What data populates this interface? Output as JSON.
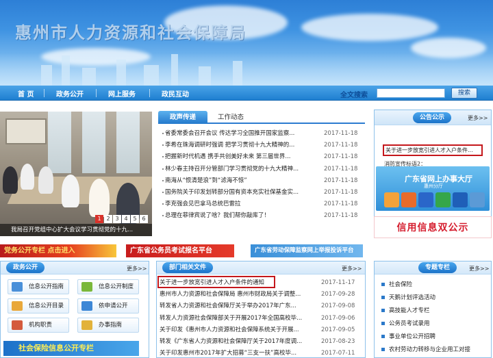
{
  "header": {
    "title": "惠州市人力资源和社会保障局"
  },
  "nav": {
    "items": [
      "首 页",
      "政务公开",
      "网上服务",
      "政民互动"
    ],
    "search_label": "全文搜索",
    "search_button": "搜索"
  },
  "slider": {
    "caption": "我局召开党组中心扩大会议学习贯彻党的十九...",
    "pages": [
      "1",
      "2",
      "3",
      "4",
      "5",
      "6"
    ]
  },
  "news_tabs": {
    "tabs": [
      "政声传递",
      "工作动态"
    ],
    "items": [
      {
        "title": "省委常委会召开会议 传达学习全国推开国家监察...",
        "date": "2017-11-18"
      },
      {
        "title": "李希在珠海调研时强调 把学习贯彻十九大精神的...",
        "date": "2017-11-18"
      },
      {
        "title": "把握新时代机遇 携手共创美好未来 第三届世界...",
        "date": "2017-11-18"
      },
      {
        "title": "林少春主持召开分管部门学习贯彻党的十九大精神...",
        "date": "2017-11-18"
      },
      {
        "title": "南海从“恨清楚浪”到“滤海不惊”",
        "date": "2017-11-18"
      },
      {
        "title": "国务院关于印发划转部分国有资本充实社保基金实...",
        "date": "2017-11-18"
      },
      {
        "title": "李克强会见巴拿马总统巴雷拉",
        "date": "2017-11-18"
      },
      {
        "title": "总理在菲律宾说了啥？我们帮你敲库了！",
        "date": "2017-11-18"
      }
    ]
  },
  "announcements": {
    "title": "公告公示",
    "more": "更多>>",
    "highlight": "关于进一步放宽引进人才入户条件...",
    "text": "消防宣传标语2："
  },
  "service_hall": {
    "title": "广东省网上办事大厅",
    "subtitle": "惠州分厅",
    "icons": [
      "person-icon",
      "people-icon",
      "document-icon",
      "hand-icon",
      "building-icon",
      "gear-icon"
    ]
  },
  "credit_banner": "信用信息双公示",
  "ads": {
    "party": "党务公开专栏 点击进入",
    "exam": "广东省公务员考试报名平台",
    "labor": "广东省劳动保障监察网上举报投诉平台"
  },
  "gov_open": {
    "title": "政务公开",
    "more": "更多>>",
    "buttons": [
      "信息公开指南",
      "信息公开制度",
      "信息公开目录",
      "依申请公开",
      "机构职责",
      "办事指南"
    ],
    "social_banner": "社会保险信息公开专栏"
  },
  "dept_docs": {
    "title": "部门相关文件",
    "more": "更多>>",
    "items": [
      {
        "title": "关于进一步放宽引进人才入户条件的通知",
        "date": "2017-11-17"
      },
      {
        "title": "惠州市人力资源和社会保障局 惠州市财政局关于调整...",
        "date": "2017-09-28"
      },
      {
        "title": "转发省人力资源和社会保障厅关于举办2017年广东...",
        "date": "2017-09-08"
      },
      {
        "title": "转发人力资源社会保障部关于开展2017年全国高校毕...",
        "date": "2017-09-06"
      },
      {
        "title": "关于印发《惠州市人力资源和社会保障系统关于开展...",
        "date": "2017-09-05"
      },
      {
        "title": "转发《广东省人力资源和社会保障厅关于2017年度调...",
        "date": "2017-08-23"
      },
      {
        "title": "关于印发惠州市2017年扩大招募“三支一扶”高校毕...",
        "date": "2017-07-11"
      }
    ]
  },
  "topics": {
    "title": "专题专栏",
    "more": "更多>>",
    "items": [
      "社会保险",
      "天鹅计划评选活动",
      "高技能人才专栏",
      "公务员考试录用",
      "事业单位公开招聘",
      "农村劳动力转移与企业用工对接"
    ]
  }
}
